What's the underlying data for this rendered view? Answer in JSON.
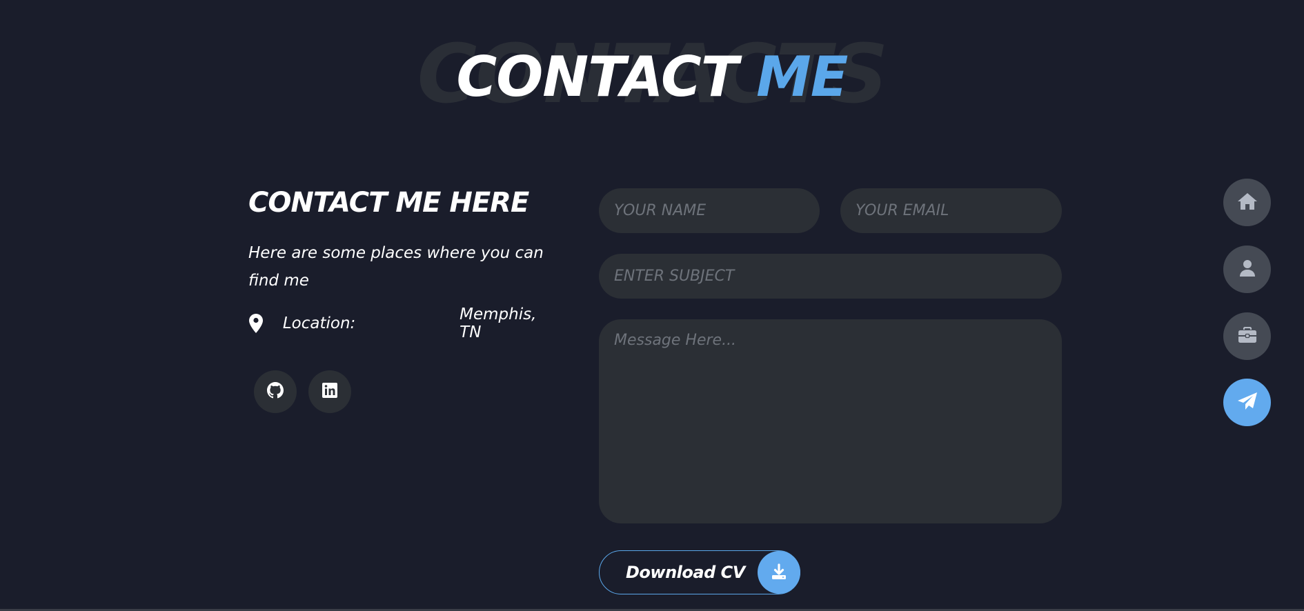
{
  "title": {
    "background_text": "CONTACTS",
    "main_white": "CONTACT",
    "main_blue": "ME"
  },
  "info": {
    "heading": "CONTACT ME HERE",
    "text": "Here are some places where you can find me",
    "location_label": "Location:",
    "location_value": "Memphis, TN"
  },
  "socials": [
    {
      "name": "GitHub",
      "icon": "github-icon"
    },
    {
      "name": "LinkedIn",
      "icon": "linkedin-icon"
    }
  ],
  "form": {
    "name_placeholder": "YOUR NAME",
    "email_placeholder": "YOUR EMAIL",
    "subject_placeholder": "ENTER SUBJECT",
    "message_placeholder": "Message Here..."
  },
  "cv_button": {
    "label": "Download CV",
    "icon": "download-icon"
  },
  "nav": [
    {
      "icon": "home-icon",
      "active": false
    },
    {
      "icon": "user-icon",
      "active": false
    },
    {
      "icon": "briefcase-icon",
      "active": false
    },
    {
      "icon": "paper-plane-icon",
      "active": true
    }
  ],
  "colors": {
    "background": "#1a1d2b",
    "accent": "#5ba7ea",
    "field": "#2b2f35",
    "nav_inactive": "#454a54",
    "title_shadow": "#2a2e36"
  }
}
